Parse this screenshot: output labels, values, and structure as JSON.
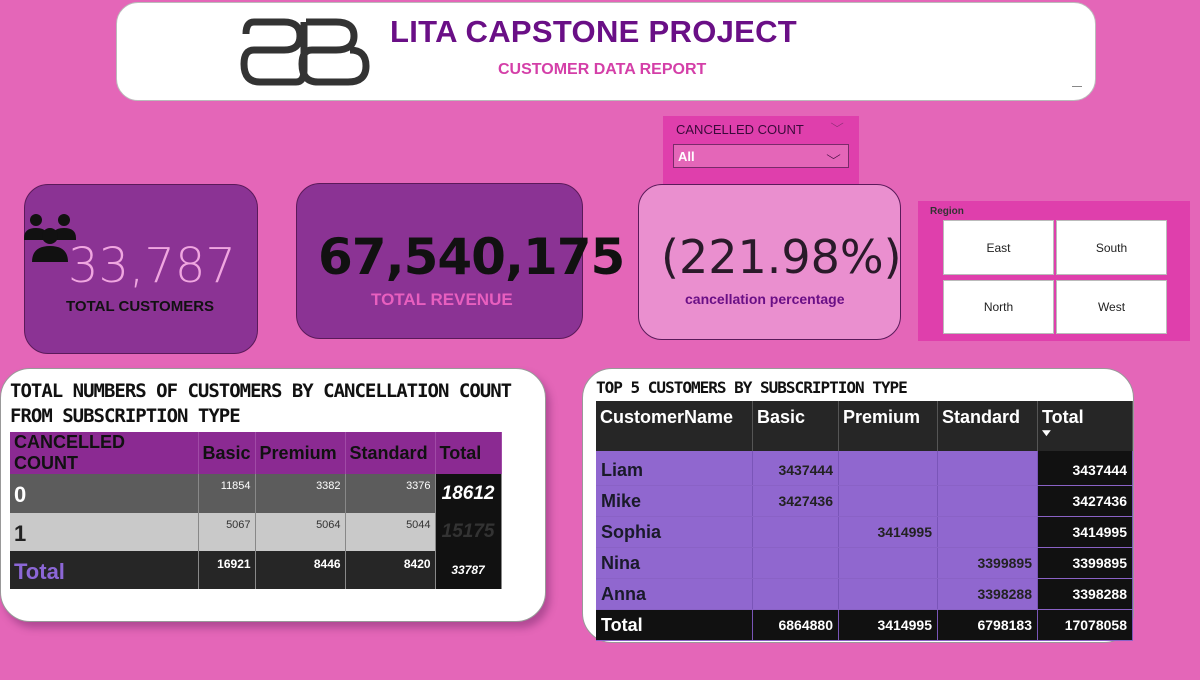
{
  "header": {
    "title": "LITA CAPSTONE PROJECT",
    "subtitle": "CUSTOMER DATA REPORT"
  },
  "slicer": {
    "title": "CANCELLED COUNT",
    "value": "All"
  },
  "kpis": {
    "customers": {
      "value": "33,787",
      "label": "TOTAL CUSTOMERS"
    },
    "revenue": {
      "value": "67,540,175",
      "label": "TOTAL REVENUE"
    },
    "cancellation": {
      "value": "(221.98%)",
      "label": "cancellation percentage"
    }
  },
  "region": {
    "title": "Region",
    "tiles": [
      "East",
      "South",
      "North",
      "West"
    ]
  },
  "table1": {
    "title": "TOTAL NUMBERS OF CUSTOMERS BY CANCELLATION COUNT FROM SUBSCRIPTION TYPE",
    "headers": [
      "CANCELLED COUNT",
      "Basic",
      "Premium",
      "Standard",
      "Total"
    ],
    "rows": [
      {
        "label": "0",
        "basic": "11854",
        "premium": "3382",
        "standard": "3376",
        "total": "18612"
      },
      {
        "label": "1",
        "basic": "5067",
        "premium": "5064",
        "standard": "5044",
        "total": "15175"
      },
      {
        "label": "Total",
        "basic": "16921",
        "premium": "8446",
        "standard": "8420",
        "total": "33787"
      }
    ]
  },
  "table2": {
    "title": "TOP 5 CUSTOMERS BY SUBSCRIPTION TYPE",
    "headers": [
      "CustomerName",
      "Basic",
      "Premium",
      "Standard",
      "Total"
    ],
    "rows": [
      {
        "name": "Liam",
        "basic": "3437444",
        "premium": "",
        "standard": "",
        "total": "3437444"
      },
      {
        "name": "Mike",
        "basic": "3427436",
        "premium": "",
        "standard": "",
        "total": "3427436"
      },
      {
        "name": "Sophia",
        "basic": "",
        "premium": "3414995",
        "standard": "",
        "total": "3414995"
      },
      {
        "name": "Nina",
        "basic": "",
        "premium": "",
        "standard": "3399895",
        "total": "3399895"
      },
      {
        "name": "Anna",
        "basic": "",
        "premium": "",
        "standard": "3398288",
        "total": "3398288"
      }
    ],
    "total_row": {
      "name": "Total",
      "basic": "6864880",
      "premium": "3414995",
      "standard": "6798183",
      "total": "17078058"
    }
  },
  "colors": {
    "background": "#e466b8",
    "kpi_purple": "#8b3394",
    "title_purple": "#6a0f86",
    "table_purple": "#9067cf"
  },
  "icons": [
    "logo-bb",
    "people-group-icon",
    "chevron-down-icon",
    "sort-desc-icon"
  ]
}
